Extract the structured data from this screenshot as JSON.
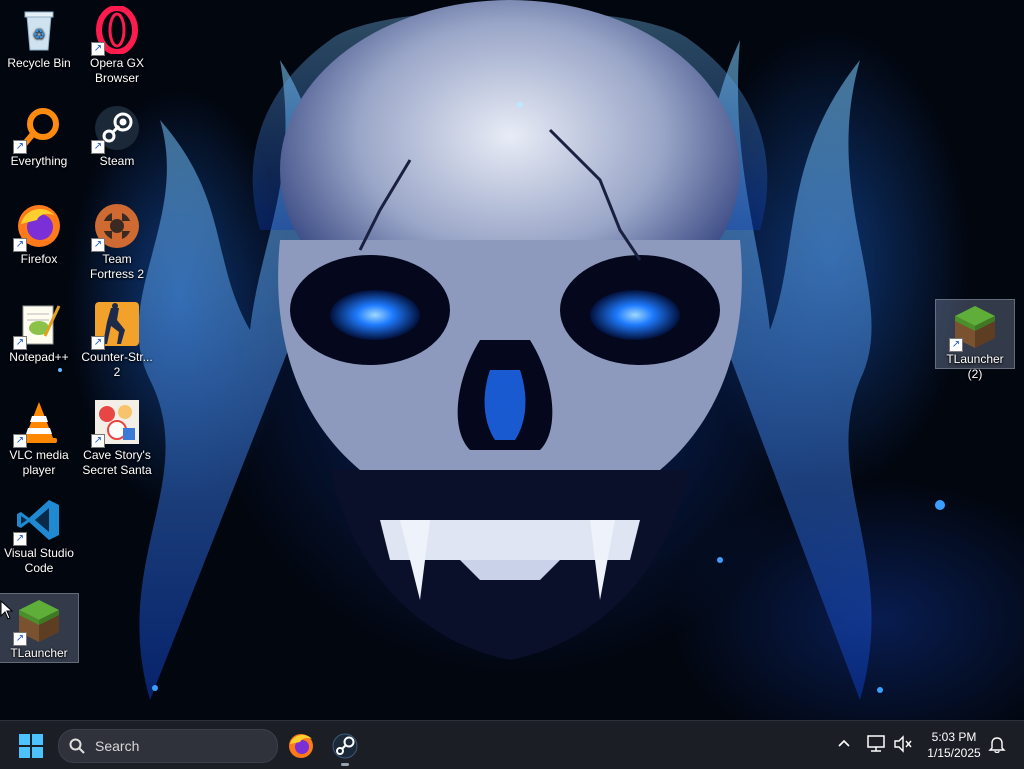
{
  "desktop": {
    "icons": [
      {
        "label": "Recycle Bin",
        "icon": "recycle-bin-icon"
      },
      {
        "label": "Opera GX Browser",
        "icon": "opera-gx-icon"
      },
      {
        "label": "Everything",
        "icon": "everything-search-icon"
      },
      {
        "label": "Steam",
        "icon": "steam-icon"
      },
      {
        "label": "Firefox",
        "icon": "firefox-icon"
      },
      {
        "label": "Team Fortress 2",
        "icon": "team-fortress-icon"
      },
      {
        "label": "Notepad++",
        "icon": "notepad-plus-plus-icon"
      },
      {
        "label": "Counter-Str... 2",
        "icon": "counter-strike-icon"
      },
      {
        "label": "VLC media player",
        "icon": "vlc-icon"
      },
      {
        "label": "Cave Story's Secret Santa",
        "icon": "cave-story-icon"
      },
      {
        "label": "Visual Studio Code",
        "icon": "vscode-icon"
      },
      {
        "label": "TLauncher",
        "icon": "minecraft-grass-block-icon"
      },
      {
        "label": "TLauncher (2)",
        "icon": "minecraft-grass-block-icon"
      }
    ]
  },
  "taskbar": {
    "search_placeholder": "Search",
    "pinned": [
      {
        "name": "Firefox",
        "icon": "firefox-icon"
      },
      {
        "name": "Steam",
        "icon": "steam-icon",
        "running": true
      }
    ],
    "tray": {
      "chevron": "chevron-up-icon",
      "network": "network-icon",
      "volume": "volume-muted-icon",
      "notifications": "bell-icon"
    },
    "clock": {
      "time": "5:03 PM",
      "date": "1/15/2025"
    }
  },
  "colors": {
    "taskbar_bg": "#1c1e26",
    "accent_blue": "#1e90ff"
  }
}
